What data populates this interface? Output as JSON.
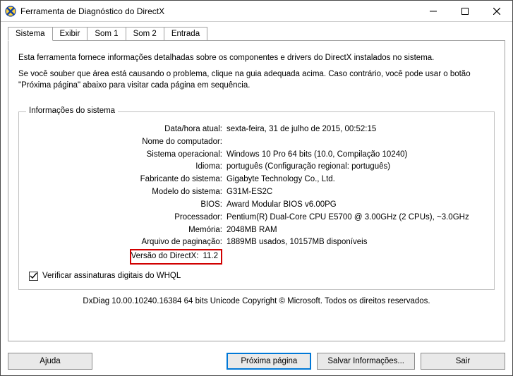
{
  "window": {
    "title": "Ferramenta de Diagnóstico do DirectX"
  },
  "tabs": {
    "system": "Sistema",
    "display": "Exibir",
    "sound1": "Som 1",
    "sound2": "Som 2",
    "input": "Entrada"
  },
  "intro": {
    "p1": "Esta ferramenta fornece informações detalhadas sobre os componentes e drivers do DirectX instalados no sistema.",
    "p2": "Se você souber que área está causando o problema, clique na guia adequada acima. Caso contrário, você pode usar o botão \"Próxima página\" abaixo para visitar cada página em sequência."
  },
  "group": {
    "legend": "Informações do sistema"
  },
  "info": {
    "datetime": {
      "label": "Data/hora atual:",
      "value": "sexta-feira, 31 de julho de 2015, 00:52:15"
    },
    "computer": {
      "label": "Nome do computador:",
      "value": ""
    },
    "os": {
      "label": "Sistema operacional:",
      "value": "Windows 10 Pro 64 bits (10.0, Compilação 10240)"
    },
    "language": {
      "label": "Idioma:",
      "value": "português (Configuração regional: português)"
    },
    "manufacturer": {
      "label": "Fabricante do sistema:",
      "value": "Gigabyte Technology Co., Ltd."
    },
    "model": {
      "label": "Modelo do sistema:",
      "value": "G31M-ES2C"
    },
    "bios": {
      "label": "BIOS:",
      "value": "Award Modular BIOS v6.00PG"
    },
    "processor": {
      "label": "Processador:",
      "value": "Pentium(R) Dual-Core  CPU     E5700   @ 3.00GHz (2 CPUs), ~3.0GHz"
    },
    "memory": {
      "label": "Memória:",
      "value": "2048MB RAM"
    },
    "pagefile": {
      "label": "Arquivo de paginação:",
      "value": "1889MB usados, 10157MB disponíveis"
    },
    "directx": {
      "label": "Versão do DirectX:",
      "value": "11.2"
    }
  },
  "checkbox": {
    "label": "Verificar assinaturas digitais do WHQL"
  },
  "footer": {
    "text": "DxDiag 10.00.10240.16384 64 bits Unicode  Copyright © Microsoft. Todos os direitos reservados."
  },
  "buttons": {
    "help": "Ajuda",
    "next": "Próxima página",
    "save": "Salvar Informações...",
    "exit": "Sair"
  }
}
